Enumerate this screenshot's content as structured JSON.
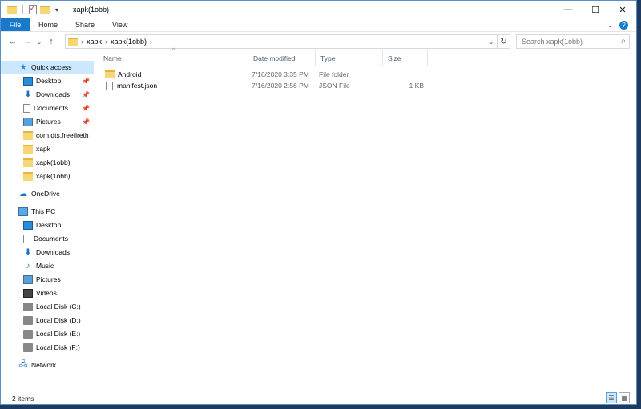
{
  "window": {
    "title": "xapk(1obb)",
    "controls": {
      "minimize": "—",
      "maximize": "☐",
      "close": "✕"
    }
  },
  "ribbon": {
    "tabs": [
      "File",
      "Home",
      "Share",
      "View"
    ],
    "expand_glyph": "⌄",
    "help_glyph": "?"
  },
  "address_bar": {
    "back": "←",
    "forward": "→",
    "recent": "⌄",
    "up": "↑",
    "path": [
      "xapk",
      "xapk(1obb)"
    ],
    "refresh": "↻",
    "search_placeholder": "Search xapk(1obb)"
  },
  "nav_pane": {
    "quick_access": "Quick access",
    "quick_items": [
      {
        "label": "Desktop",
        "icon": "desktop-icon",
        "pinned": true
      },
      {
        "label": "Downloads",
        "icon": "downloads-icon",
        "pinned": true
      },
      {
        "label": "Documents",
        "icon": "documents-icon",
        "pinned": true
      },
      {
        "label": "Pictures",
        "icon": "pictures-icon",
        "pinned": true
      },
      {
        "label": "com.dts.freefireth",
        "icon": "folder-icon",
        "pinned": false
      },
      {
        "label": "xapk",
        "icon": "folder-icon",
        "pinned": false
      },
      {
        "label": "xapk(1obb)",
        "icon": "folder-icon",
        "pinned": false
      },
      {
        "label": "xapk(1obb)",
        "icon": "folder-icon",
        "pinned": false
      }
    ],
    "onedrive": "OneDrive",
    "this_pc": "This PC",
    "pc_items": [
      {
        "label": "Desktop",
        "icon": "desktop-icon"
      },
      {
        "label": "Documents",
        "icon": "documents-icon"
      },
      {
        "label": "Downloads",
        "icon": "downloads-icon"
      },
      {
        "label": "Music",
        "icon": "music-icon"
      },
      {
        "label": "Pictures",
        "icon": "pictures-icon"
      },
      {
        "label": "Videos",
        "icon": "videos-icon"
      },
      {
        "label": "Local Disk (C:)",
        "icon": "disk-icon"
      },
      {
        "label": "Local Disk (D:)",
        "icon": "disk-icon"
      },
      {
        "label": "Local Disk (E:)",
        "icon": "disk-icon"
      },
      {
        "label": "Local Disk (F:)",
        "icon": "disk-icon"
      }
    ],
    "network": "Network"
  },
  "file_list": {
    "columns": [
      "Name",
      "Date modified",
      "Type",
      "Size"
    ],
    "sort_glyph": "^",
    "rows": [
      {
        "name": "Android",
        "date": "7/16/2020 3:35 PM",
        "type": "File folder",
        "size": "",
        "kind": "folder"
      },
      {
        "name": "manifest.json",
        "date": "7/16/2020 2:56 PM",
        "type": "JSON File",
        "size": "1 KB",
        "kind": "file"
      }
    ]
  },
  "status_bar": {
    "item_count": "2 items"
  },
  "colors": {
    "accent": "#1979ca",
    "selection": "#cce8ff",
    "folder": "#f7d675"
  }
}
